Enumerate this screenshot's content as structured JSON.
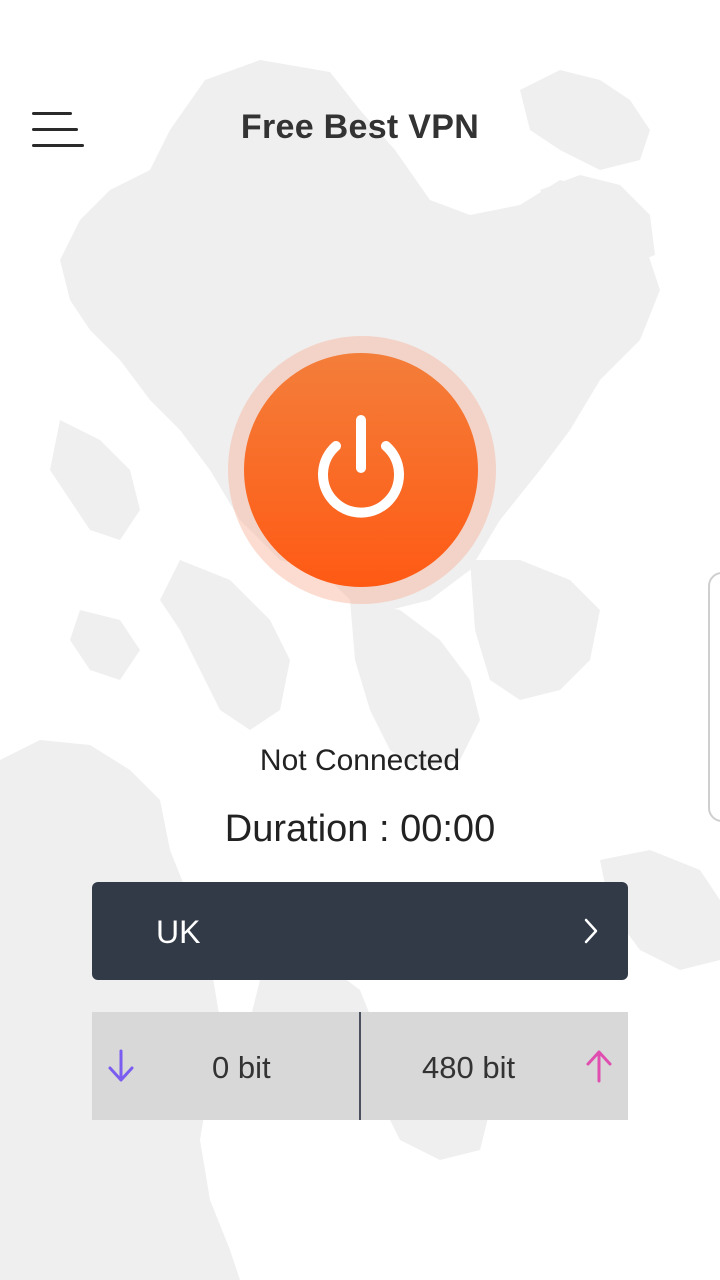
{
  "header": {
    "title": "Free Best VPN",
    "menu_icon": "menu-icon"
  },
  "connection": {
    "status": "Not Connected",
    "duration_label": "Duration :",
    "duration_value": "00:00",
    "power_icon": "power-icon"
  },
  "server": {
    "name": "UK",
    "chevron_icon": "chevron-right-icon"
  },
  "traffic": {
    "download": "0 bit",
    "upload": "480 bit",
    "download_icon": "arrow-down-icon",
    "upload_icon": "arrow-up-icon"
  },
  "colors": {
    "accent": "#ff5a14",
    "server_bar": "#323a48",
    "download_arrow": "#7b5cf0",
    "upload_arrow": "#e04fb0"
  }
}
